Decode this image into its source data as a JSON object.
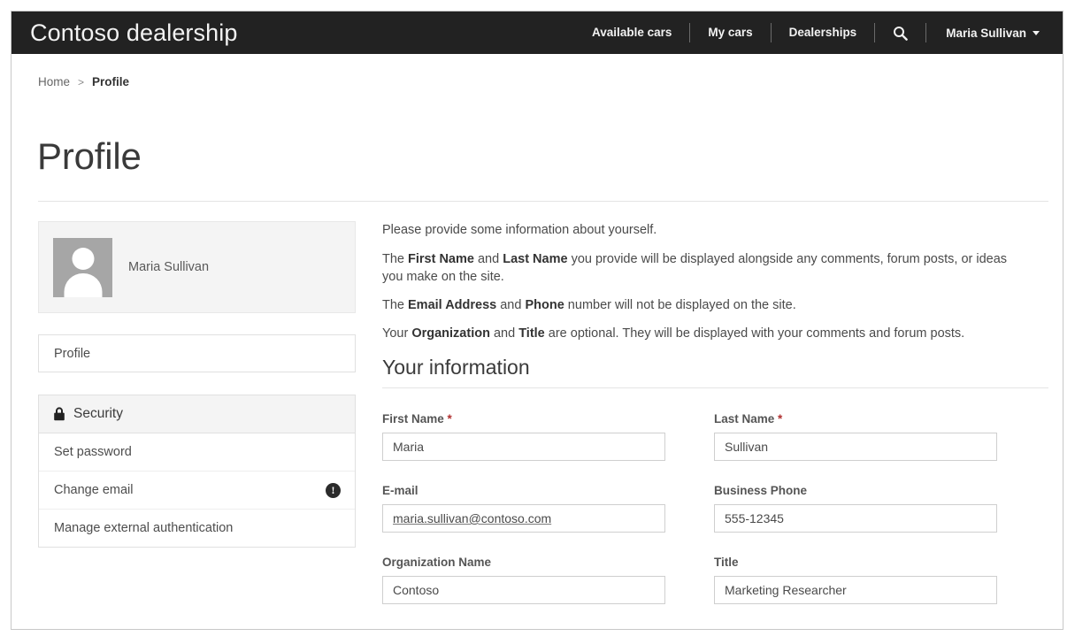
{
  "navbar": {
    "brand": "Contoso dealership",
    "links": [
      {
        "label": "Available cars"
      },
      {
        "label": "My cars"
      },
      {
        "label": "Dealerships"
      }
    ],
    "search_icon": "search-icon",
    "user": "Maria Sullivan"
  },
  "breadcrumb": {
    "home": "Home",
    "separator": ">",
    "current": "Profile"
  },
  "page": {
    "title": "Profile"
  },
  "sidebar": {
    "profile_card": {
      "name": "Maria Sullivan",
      "avatar_icon": "user-avatar-placeholder"
    },
    "profile_nav_label": "Profile",
    "security": {
      "icon": "lock-icon",
      "title": "Security",
      "items": [
        {
          "label": "Set password",
          "badge": ""
        },
        {
          "label": "Change email",
          "badge": "!",
          "badge_icon": "alert-circle-icon"
        },
        {
          "label": "Manage external authentication",
          "badge": ""
        }
      ]
    }
  },
  "main": {
    "intro": {
      "p1": "Please provide some information about yourself.",
      "p2_a": "The ",
      "p2_b1": "First Name",
      "p2_c": " and ",
      "p2_b2": "Last Name",
      "p2_d": " you provide will be displayed alongside any comments, forum posts, or ideas you make on the site.",
      "p3_a": "The ",
      "p3_b1": "Email Address",
      "p3_c": " and ",
      "p3_b2": "Phone",
      "p3_d": " number will not be displayed on the site.",
      "p4_a": "Your ",
      "p4_b1": "Organization",
      "p4_c": " and ",
      "p4_b2": "Title",
      "p4_d": " are optional. They will be displayed with your comments and forum posts."
    },
    "section_title": "Your information",
    "fields": {
      "first_name": {
        "label": "First Name",
        "required": "*",
        "value": "Maria",
        "placeholder": ""
      },
      "last_name": {
        "label": "Last Name",
        "required": "*",
        "value": "Sullivan",
        "placeholder": ""
      },
      "email": {
        "label": "E-mail",
        "required": "",
        "value": "maria.sullivan@contoso.com",
        "placeholder": ""
      },
      "phone": {
        "label": "Business Phone",
        "required": "",
        "value": "555-12345",
        "placeholder": ""
      },
      "organization": {
        "label": "Organization Name",
        "required": "",
        "value": "Contoso",
        "placeholder": ""
      },
      "title": {
        "label": "Title",
        "required": "",
        "value": "Marketing Researcher",
        "placeholder": ""
      }
    }
  },
  "colors": {
    "navbar_bg": "#222222",
    "accent_required": "#b03030",
    "panel_bg": "#f4f4f4",
    "border": "#e0e0e0"
  }
}
